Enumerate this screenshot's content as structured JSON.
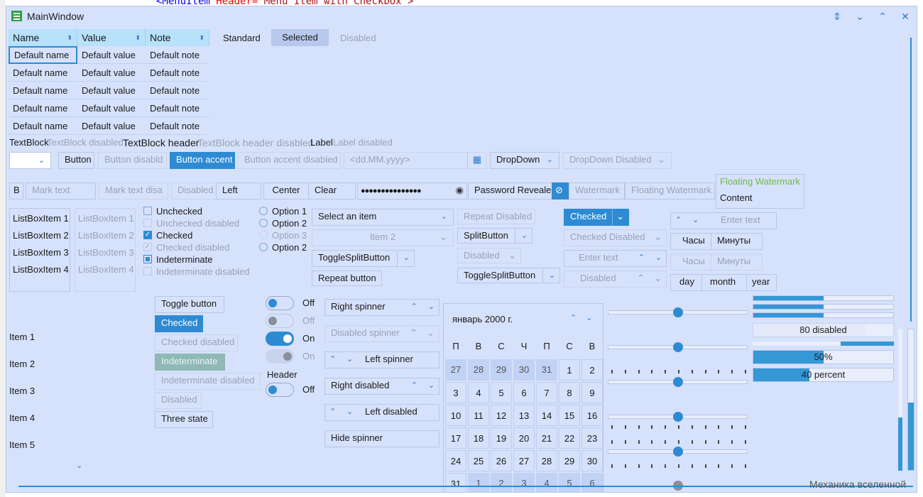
{
  "background_code": {
    "tag": "<MenuItem ",
    "attr": "Header=",
    "value": "\"Menu Item with  Checkbox\">"
  },
  "window": {
    "title": "MainWindow"
  },
  "grid": {
    "headers": [
      "Name",
      "Value",
      "Note"
    ],
    "rows": [
      [
        "Default name",
        "Default value",
        "Default note"
      ],
      [
        "Default name",
        "Default value",
        "Default note"
      ],
      [
        "Default name",
        "Default value",
        "Default note"
      ],
      [
        "Default name",
        "Default value",
        "Default note"
      ],
      [
        "Default name",
        "Default value",
        "Default note"
      ]
    ]
  },
  "tabs": {
    "standard": "Standard",
    "selected": "Selected",
    "disabled": "Disabled"
  },
  "textblocks": {
    "tb": "TextBlock",
    "tb_dis": "TextBlock disabled",
    "tb_hdr": "TextBlock header",
    "tb_hdr_dis": "TextBlock header disabled",
    "label": "Label",
    "label_dis": "Label disabled"
  },
  "row1": {
    "button": "Button",
    "button_dis": "Button disabld",
    "button_accent": "Button accent",
    "button_accent_dis": "Button accent disabled",
    "date_placeholder": "<dd.MM.yyyy>",
    "dropdown": "DropDown",
    "dropdown_dis": "DropDown Disabled"
  },
  "row2": {
    "b": "B",
    "mark_text": "Mark text",
    "mark_text_dis": "Mark text disa",
    "disabled": "Disabled",
    "left": "Left",
    "center": "Center",
    "clear": "Clear",
    "password": "●●●●●●●●●●●●●●●",
    "password_revealed": "Password Revealed",
    "watermark": "Watermark",
    "floating_watermark": "Floating Watermark",
    "floating_label": "Floating Watermark",
    "content": "Content"
  },
  "listbox": {
    "items": [
      "ListBoxItem 1",
      "ListBoxItem 2",
      "ListBoxItem 3",
      "ListBoxItem 4"
    ]
  },
  "checkboxes": {
    "unchecked": "Unchecked",
    "unchecked_dis": "Unchecked disabled",
    "checked": "Checked",
    "checked_dis": "Checked disabled",
    "indeterminate": "Indeterminate",
    "indeterminate_dis": "Indeterminate disabled"
  },
  "radios": [
    "Option 1",
    "Option 2",
    "Option 3",
    "Option 2"
  ],
  "combos": {
    "select": "Select an item",
    "item2": "Item 2",
    "toggle_split": "ToggleSplitButton",
    "repeat": "Repeat button"
  },
  "split": {
    "repeat_dis": "Repeat Disabled",
    "split": "SplitButton",
    "disabled": "Disabled",
    "toggle_split": "ToggleSplitButton"
  },
  "right_col": {
    "checked": "Checked",
    "checked_dis": "Checked Disabled",
    "enter_text": "Enter text",
    "disabled": "Disabled"
  },
  "time": {
    "enter_text": "Enter text",
    "hours": "Часы",
    "minutes": "Минуты",
    "day": "day",
    "month": "month",
    "year": "year"
  },
  "toggle_buttons": {
    "toggle": "Toggle button",
    "checked": "Checked",
    "checked_dis": "Checked disabled",
    "indeterminate": "Indeterminate",
    "indeterminate_dis": "Indeterminate disabled",
    "disabled": "Disabled",
    "three_state": "Three state"
  },
  "switches": {
    "off": "Off",
    "on": "On",
    "header": "Header"
  },
  "spinners": {
    "right": "Right spinner",
    "disabled": "Disabled spinner",
    "left": "Left spinner",
    "right_dis": "Right disabled",
    "left_dis": "Left disabled",
    "hide": "Hide spinner"
  },
  "left_list": {
    "items": [
      "Item 1",
      "Item 2",
      "Item 3",
      "Item 4",
      "Item 5"
    ]
  },
  "calendar": {
    "title": "январь 2000 г.",
    "dow": [
      "П",
      "В",
      "С",
      "Ч",
      "П",
      "С",
      "В"
    ],
    "weeks": [
      [
        "27",
        "28",
        "29",
        "30",
        "31",
        "1",
        "2"
      ],
      [
        "3",
        "4",
        "5",
        "6",
        "7",
        "8",
        "9"
      ],
      [
        "10",
        "11",
        "12",
        "13",
        "14",
        "15",
        "16"
      ],
      [
        "17",
        "18",
        "19",
        "20",
        "21",
        "22",
        "23"
      ],
      [
        "24",
        "25",
        "26",
        "27",
        "28",
        "29",
        "30"
      ],
      [
        "31",
        "1",
        "2",
        "3",
        "4",
        "5",
        "6"
      ]
    ]
  },
  "progress": {
    "disabled_label": "80 disabled",
    "disabled_value": 0.8,
    "pct_label": "50%",
    "pct_value": 0.5,
    "percent_label": "40 percent",
    "percent_value": 0.4,
    "bars": [
      0.5,
      0.5,
      0.5
    ]
  },
  "footer_text": "Механика вселенной",
  "colors": {
    "accent": "#2e8bd3",
    "window_bg": "#d6e1fb",
    "header_bg": "#b8e1fb"
  }
}
